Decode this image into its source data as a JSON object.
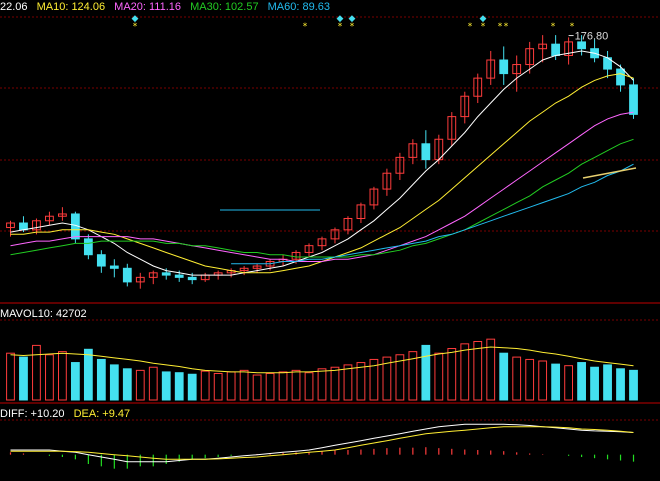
{
  "colors": {
    "background": "#000000",
    "grid": "#7a0000",
    "up": "#ff3c3c",
    "down": "#44e0f0",
    "ma5": "#ffffff",
    "ma10": "#ffee33",
    "ma20": "#ff66ff",
    "ma30": "#22cc22",
    "ma60": "#22bbee",
    "extra": "#e8d070",
    "marker": "#ffee33",
    "marker_alt": "#44e0f0",
    "macd_pos": "#ff3c3c",
    "macd_neg": "#22dd22"
  },
  "price_legend": {
    "ma5": "22.06",
    "ma10": "MA10: 124.06",
    "ma20": "MA20: 111.16",
    "ma30": "MA30: 102.57",
    "ma60": "MA60: 89.63"
  },
  "volume_legend": {
    "mavol10": "MAVOL10: 42702"
  },
  "macd_legend": {
    "diff": "DIFF: +10.20",
    "dea": "DEA: +9.47"
  },
  "chart_data": [
    {
      "type": "candlestick",
      "panel": "price",
      "ylim": [
        60,
        185
      ],
      "annotations": [
        {
          "text": "176.80",
          "bar": 43
        }
      ],
      "series": [
        {
          "name": "price",
          "values": [
            [
              92,
              95,
              88,
              94
            ],
            [
              94,
              97,
              90,
              91
            ],
            [
              91,
              96,
              89,
              95
            ],
            [
              95,
              99,
              93,
              97
            ],
            [
              97,
              101,
              95,
              98
            ],
            [
              98,
              99,
              85,
              87
            ],
            [
              87,
              89,
              78,
              80
            ],
            [
              80,
              82,
              72,
              75
            ],
            [
              75,
              78,
              70,
              74
            ],
            [
              74,
              76,
              66,
              68
            ],
            [
              68,
              72,
              65,
              70
            ],
            [
              70,
              73,
              67,
              72
            ],
            [
              72,
              74,
              69,
              71
            ],
            [
              71,
              73,
              68,
              70
            ],
            [
              70,
              72,
              67,
              69
            ],
            [
              69,
              72,
              68,
              71
            ],
            [
              71,
              73,
              69,
              72
            ],
            [
              72,
              74,
              70,
              73
            ],
            [
              73,
              75,
              71,
              74
            ],
            [
              74,
              76,
              72,
              75
            ],
            [
              75,
              78,
              73,
              77
            ],
            [
              77,
              80,
              75,
              78
            ],
            [
              78,
              82,
              76,
              81
            ],
            [
              81,
              85,
              79,
              84
            ],
            [
              84,
              88,
              82,
              87
            ],
            [
              87,
              92,
              85,
              91
            ],
            [
              91,
              97,
              89,
              96
            ],
            [
              96,
              103,
              94,
              102
            ],
            [
              102,
              110,
              100,
              109
            ],
            [
              109,
              118,
              106,
              116
            ],
            [
              116,
              125,
              113,
              123
            ],
            [
              123,
              131,
              120,
              129
            ],
            [
              129,
              135,
              118,
              122
            ],
            [
              122,
              133,
              120,
              131
            ],
            [
              131,
              143,
              128,
              141
            ],
            [
              141,
              152,
              138,
              150
            ],
            [
              150,
              160,
              147,
              158
            ],
            [
              158,
              170,
              155,
              166
            ],
            [
              166,
              172,
              155,
              160
            ],
            [
              160,
              168,
              152,
              164
            ],
            [
              164,
              174,
              160,
              171
            ],
            [
              171,
              177,
              165,
              173
            ],
            [
              173,
              177,
              166,
              168
            ],
            [
              168,
              176,
              164,
              174
            ],
            [
              174,
              177,
              168,
              171
            ],
            [
              171,
              175,
              165,
              167
            ],
            [
              167,
              170,
              158,
              162
            ],
            [
              162,
              164,
              152,
              155
            ],
            [
              155,
              158,
              140,
              142
            ]
          ]
        },
        {
          "name": "MA5",
          "values": [
            90,
            91,
            92,
            93,
            94,
            93,
            91,
            88,
            85,
            81,
            78,
            75,
            73,
            72,
            71,
            71,
            71,
            71,
            72,
            73,
            74,
            75,
            77,
            79,
            81,
            84,
            87,
            91,
            95,
            100,
            105,
            111,
            117,
            122,
            128,
            134,
            141,
            147,
            153,
            158,
            162,
            166,
            168,
            169,
            170,
            169,
            167,
            163,
            157
          ]
        },
        {
          "name": "MA10",
          "values": [
            89,
            89,
            90,
            90,
            91,
            91,
            91,
            90,
            89,
            87,
            85,
            83,
            81,
            79,
            77,
            75,
            74,
            73,
            72,
            72,
            72,
            73,
            74,
            75,
            77,
            79,
            81,
            83,
            86,
            89,
            92,
            96,
            100,
            104,
            109,
            114,
            119,
            124,
            129,
            134,
            139,
            143,
            147,
            150,
            154,
            157,
            159,
            160,
            158
          ]
        },
        {
          "name": "MA20",
          "values": [
            84,
            85,
            86,
            86,
            87,
            88,
            88,
            88,
            88,
            88,
            87,
            87,
            86,
            85,
            84,
            83,
            82,
            81,
            80,
            79,
            78,
            78,
            77,
            77,
            77,
            78,
            78,
            79,
            80,
            82,
            84,
            86,
            88,
            91,
            94,
            97,
            101,
            105,
            109,
            113,
            117,
            121,
            125,
            129,
            133,
            137,
            140,
            142,
            143
          ]
        },
        {
          "name": "MA30",
          "values": [
            80,
            81,
            82,
            83,
            84,
            85,
            85,
            86,
            86,
            86,
            86,
            86,
            85,
            85,
            84,
            84,
            83,
            82,
            81,
            81,
            80,
            80,
            79,
            79,
            79,
            79,
            79,
            80,
            80,
            81,
            82,
            84,
            85,
            87,
            89,
            91,
            94,
            97,
            100,
            103,
            106,
            110,
            113,
            116,
            120,
            123,
            126,
            129,
            131
          ]
        },
        {
          "name": "MA60",
          "values": [
            null,
            null,
            null,
            null,
            null,
            null,
            null,
            null,
            null,
            null,
            null,
            null,
            null,
            null,
            null,
            null,
            null,
            76,
            76,
            76,
            76,
            77,
            77,
            78,
            78,
            79,
            80,
            81,
            82,
            83,
            84,
            85,
            86,
            88,
            89,
            91,
            93,
            95,
            97,
            99,
            101,
            103,
            105,
            107,
            110,
            112,
            115,
            117,
            120
          ]
        }
      ]
    },
    {
      "type": "bar",
      "panel": "volume",
      "ylim": [
        0,
        100
      ],
      "series": [
        {
          "name": "volume",
          "values": [
            60,
            55,
            70,
            58,
            62,
            48,
            65,
            52,
            45,
            40,
            38,
            42,
            36,
            35,
            33,
            37,
            34,
            36,
            38,
            32,
            34,
            36,
            38,
            35,
            40,
            42,
            45,
            48,
            52,
            55,
            58,
            62,
            70,
            60,
            66,
            72,
            75,
            78,
            60,
            55,
            52,
            50,
            46,
            44,
            48,
            42,
            45,
            40,
            38
          ]
        },
        {
          "name": "MAVOL10",
          "values": [
            58,
            57,
            58,
            59,
            60,
            59,
            58,
            56,
            54,
            52,
            50,
            47,
            45,
            43,
            40,
            38,
            37,
            36,
            36,
            35,
            35,
            35,
            36,
            36,
            37,
            38,
            40,
            42,
            44,
            47,
            50,
            53,
            56,
            59,
            61,
            64,
            66,
            68,
            67,
            66,
            64,
            61,
            59,
            56,
            53,
            50,
            48,
            46,
            44
          ]
        }
      ]
    },
    {
      "type": "bar",
      "panel": "macd",
      "ylim": [
        -10,
        14
      ],
      "series": [
        {
          "name": "MACD",
          "values": [
            1,
            0.5,
            0,
            -0.5,
            -1,
            -2,
            -4,
            -5,
            -6,
            -6,
            -5,
            -5,
            -4,
            -3,
            -2,
            -1.5,
            -1,
            -0.5,
            0,
            0.3,
            0.5,
            0.8,
            1,
            1.2,
            1.5,
            1.8,
            2,
            2.2,
            2.5,
            2.8,
            3,
            3,
            3.2,
            2.8,
            2.5,
            2.2,
            2,
            1.8,
            1.5,
            1,
            0.5,
            0.2,
            0,
            -0.5,
            -1,
            -1.5,
            -2,
            -2.5,
            -3
          ]
        },
        {
          "name": "DIFF",
          "values": [
            2,
            2,
            2,
            2,
            1.5,
            1,
            0,
            -1,
            -2,
            -3,
            -3,
            -3,
            -3,
            -2.5,
            -2,
            -2,
            -1.5,
            -1,
            -0.5,
            0,
            0.5,
            1,
            1.5,
            2,
            3,
            4,
            5,
            6,
            7,
            8,
            9,
            10,
            11,
            12,
            12.5,
            13,
            13,
            13,
            13,
            12.8,
            12.5,
            12,
            11.5,
            11,
            10.5,
            10.2,
            10,
            9.8,
            9.5
          ]
        },
        {
          "name": "DEA",
          "values": [
            1.5,
            1.5,
            1.5,
            1.5,
            1.5,
            1.3,
            1,
            0.5,
            0,
            -0.5,
            -1,
            -1.5,
            -2,
            -2,
            -2,
            -2,
            -1.8,
            -1.5,
            -1.2,
            -1,
            -0.5,
            0,
            0.5,
            1,
            1.5,
            2,
            3,
            4,
            5,
            6,
            7,
            8,
            9,
            9.5,
            10,
            10.5,
            11,
            11.5,
            12,
            12,
            12,
            12,
            11.8,
            11.5,
            11,
            10.8,
            10.5,
            10,
            9.5
          ]
        }
      ]
    }
  ]
}
